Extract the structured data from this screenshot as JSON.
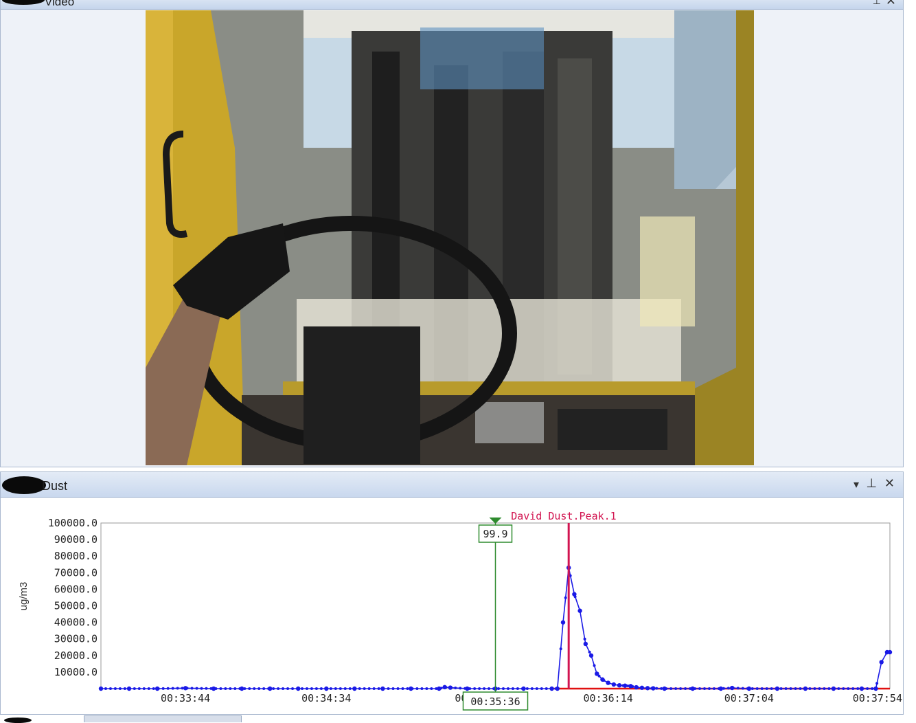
{
  "video_pane": {
    "title": "Video",
    "pin_glyph": "⊥",
    "close_glyph": "✕"
  },
  "dust_pane": {
    "title": "Dust",
    "dropdown_glyph": "▾",
    "pin_glyph": "⊥",
    "close_glyph": "✕"
  },
  "chart_data": {
    "type": "line",
    "ylabel": "ug/m3",
    "xlabel": "",
    "ylim": [
      0,
      100000
    ],
    "y_ticks": [
      "100000.0",
      "90000.0",
      "80000.0",
      "70000.0",
      "60000.0",
      "50000.0",
      "40000.0",
      "30000.0",
      "20000.0",
      "10000.0"
    ],
    "x_ticks": [
      "00:33:44",
      "00:34:34",
      "00:3",
      "00:36:14",
      "00:37:04",
      "00:37:54"
    ],
    "xlim_seconds": [
      2000,
      2280
    ],
    "grid": false,
    "series": [
      {
        "color": "#1a1ae6",
        "points": [
          [
            2000,
            0
          ],
          [
            2010,
            0
          ],
          [
            2020,
            0
          ],
          [
            2030,
            300
          ],
          [
            2040,
            0
          ],
          [
            2050,
            0
          ],
          [
            2060,
            0
          ],
          [
            2070,
            0
          ],
          [
            2080,
            0
          ],
          [
            2090,
            0
          ],
          [
            2100,
            0
          ],
          [
            2110,
            0
          ],
          [
            2120,
            0
          ],
          [
            2122,
            900
          ],
          [
            2124,
            600
          ],
          [
            2130,
            0
          ],
          [
            2140,
            0
          ],
          [
            2150,
            0
          ],
          [
            2160,
            0
          ],
          [
            2162,
            0
          ],
          [
            2164,
            40000
          ],
          [
            2166,
            73000
          ],
          [
            2168,
            57000
          ],
          [
            2170,
            47000
          ],
          [
            2172,
            27000
          ],
          [
            2174,
            20000
          ],
          [
            2176,
            9000
          ],
          [
            2178,
            5500
          ],
          [
            2180,
            3500
          ],
          [
            2182,
            2500
          ],
          [
            2184,
            2000
          ],
          [
            2186,
            1800
          ],
          [
            2188,
            1500
          ],
          [
            2190,
            800
          ],
          [
            2192,
            500
          ],
          [
            2194,
            300
          ],
          [
            2196,
            200
          ],
          [
            2200,
            0
          ],
          [
            2210,
            0
          ],
          [
            2220,
            0
          ],
          [
            2224,
            400
          ],
          [
            2230,
            0
          ],
          [
            2240,
            0
          ],
          [
            2250,
            0
          ],
          [
            2260,
            0
          ],
          [
            2270,
            0
          ],
          [
            2275,
            0
          ],
          [
            2277,
            16000
          ],
          [
            2279,
            22000
          ],
          [
            2280,
            22000
          ]
        ]
      }
    ],
    "cursor": {
      "label": "99.9",
      "time_label": "00:35:36",
      "x": 2140,
      "color": "#2e8b2e"
    },
    "peak_marker": {
      "label": "David Dust.Peak.1",
      "x": 2166,
      "color": "#d21450"
    },
    "baseline_color": "#e01010"
  }
}
